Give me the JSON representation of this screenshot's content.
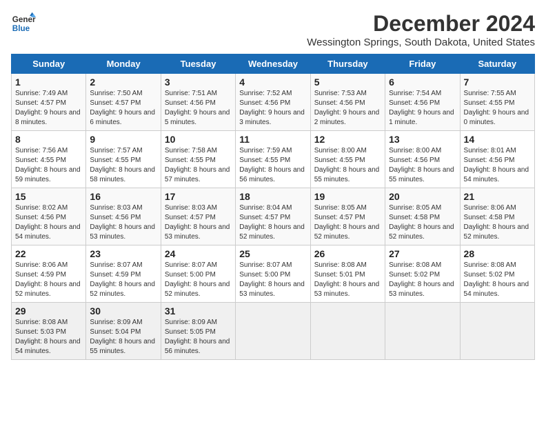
{
  "logo": {
    "line1": "General",
    "line2": "Blue"
  },
  "title": "December 2024",
  "location": "Wessington Springs, South Dakota, United States",
  "days_header": [
    "Sunday",
    "Monday",
    "Tuesday",
    "Wednesday",
    "Thursday",
    "Friday",
    "Saturday"
  ],
  "weeks": [
    [
      {
        "day": "1",
        "sunrise": "7:49 AM",
        "sunset": "4:57 PM",
        "daylight": "9 hours and 8 minutes."
      },
      {
        "day": "2",
        "sunrise": "7:50 AM",
        "sunset": "4:57 PM",
        "daylight": "9 hours and 6 minutes."
      },
      {
        "day": "3",
        "sunrise": "7:51 AM",
        "sunset": "4:56 PM",
        "daylight": "9 hours and 5 minutes."
      },
      {
        "day": "4",
        "sunrise": "7:52 AM",
        "sunset": "4:56 PM",
        "daylight": "9 hours and 3 minutes."
      },
      {
        "day": "5",
        "sunrise": "7:53 AM",
        "sunset": "4:56 PM",
        "daylight": "9 hours and 2 minutes."
      },
      {
        "day": "6",
        "sunrise": "7:54 AM",
        "sunset": "4:56 PM",
        "daylight": "9 hours and 1 minute."
      },
      {
        "day": "7",
        "sunrise": "7:55 AM",
        "sunset": "4:55 PM",
        "daylight": "9 hours and 0 minutes."
      }
    ],
    [
      {
        "day": "8",
        "sunrise": "7:56 AM",
        "sunset": "4:55 PM",
        "daylight": "8 hours and 59 minutes."
      },
      {
        "day": "9",
        "sunrise": "7:57 AM",
        "sunset": "4:55 PM",
        "daylight": "8 hours and 58 minutes."
      },
      {
        "day": "10",
        "sunrise": "7:58 AM",
        "sunset": "4:55 PM",
        "daylight": "8 hours and 57 minutes."
      },
      {
        "day": "11",
        "sunrise": "7:59 AM",
        "sunset": "4:55 PM",
        "daylight": "8 hours and 56 minutes."
      },
      {
        "day": "12",
        "sunrise": "8:00 AM",
        "sunset": "4:55 PM",
        "daylight": "8 hours and 55 minutes."
      },
      {
        "day": "13",
        "sunrise": "8:00 AM",
        "sunset": "4:56 PM",
        "daylight": "8 hours and 55 minutes."
      },
      {
        "day": "14",
        "sunrise": "8:01 AM",
        "sunset": "4:56 PM",
        "daylight": "8 hours and 54 minutes."
      }
    ],
    [
      {
        "day": "15",
        "sunrise": "8:02 AM",
        "sunset": "4:56 PM",
        "daylight": "8 hours and 54 minutes."
      },
      {
        "day": "16",
        "sunrise": "8:03 AM",
        "sunset": "4:56 PM",
        "daylight": "8 hours and 53 minutes."
      },
      {
        "day": "17",
        "sunrise": "8:03 AM",
        "sunset": "4:57 PM",
        "daylight": "8 hours and 53 minutes."
      },
      {
        "day": "18",
        "sunrise": "8:04 AM",
        "sunset": "4:57 PM",
        "daylight": "8 hours and 52 minutes."
      },
      {
        "day": "19",
        "sunrise": "8:05 AM",
        "sunset": "4:57 PM",
        "daylight": "8 hours and 52 minutes."
      },
      {
        "day": "20",
        "sunrise": "8:05 AM",
        "sunset": "4:58 PM",
        "daylight": "8 hours and 52 minutes."
      },
      {
        "day": "21",
        "sunrise": "8:06 AM",
        "sunset": "4:58 PM",
        "daylight": "8 hours and 52 minutes."
      }
    ],
    [
      {
        "day": "22",
        "sunrise": "8:06 AM",
        "sunset": "4:59 PM",
        "daylight": "8 hours and 52 minutes."
      },
      {
        "day": "23",
        "sunrise": "8:07 AM",
        "sunset": "4:59 PM",
        "daylight": "8 hours and 52 minutes."
      },
      {
        "day": "24",
        "sunrise": "8:07 AM",
        "sunset": "5:00 PM",
        "daylight": "8 hours and 52 minutes."
      },
      {
        "day": "25",
        "sunrise": "8:07 AM",
        "sunset": "5:00 PM",
        "daylight": "8 hours and 53 minutes."
      },
      {
        "day": "26",
        "sunrise": "8:08 AM",
        "sunset": "5:01 PM",
        "daylight": "8 hours and 53 minutes."
      },
      {
        "day": "27",
        "sunrise": "8:08 AM",
        "sunset": "5:02 PM",
        "daylight": "8 hours and 53 minutes."
      },
      {
        "day": "28",
        "sunrise": "8:08 AM",
        "sunset": "5:02 PM",
        "daylight": "8 hours and 54 minutes."
      }
    ],
    [
      {
        "day": "29",
        "sunrise": "8:08 AM",
        "sunset": "5:03 PM",
        "daylight": "8 hours and 54 minutes."
      },
      {
        "day": "30",
        "sunrise": "8:09 AM",
        "sunset": "5:04 PM",
        "daylight": "8 hours and 55 minutes."
      },
      {
        "day": "31",
        "sunrise": "8:09 AM",
        "sunset": "5:05 PM",
        "daylight": "8 hours and 56 minutes."
      },
      null,
      null,
      null,
      null
    ]
  ]
}
